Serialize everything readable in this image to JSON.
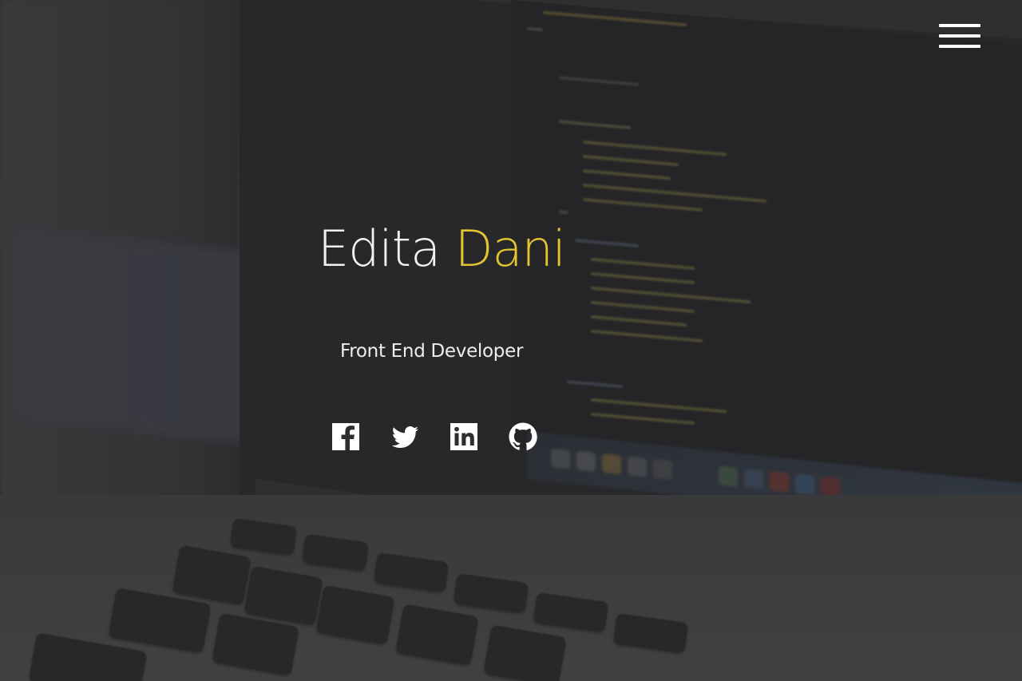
{
  "header": {
    "menu_icon": "hamburger-menu-icon"
  },
  "hero": {
    "first_name": "Edita",
    "last_name": "Dani",
    "subtitle": "Front End Developer"
  },
  "social": [
    {
      "icon": "facebook-icon"
    },
    {
      "icon": "twitter-icon"
    },
    {
      "icon": "linkedin-icon"
    },
    {
      "icon": "github-icon"
    }
  ],
  "colors": {
    "accent": "#e2c531",
    "text": "#f2f2f2",
    "background": "#2b2b2d"
  }
}
